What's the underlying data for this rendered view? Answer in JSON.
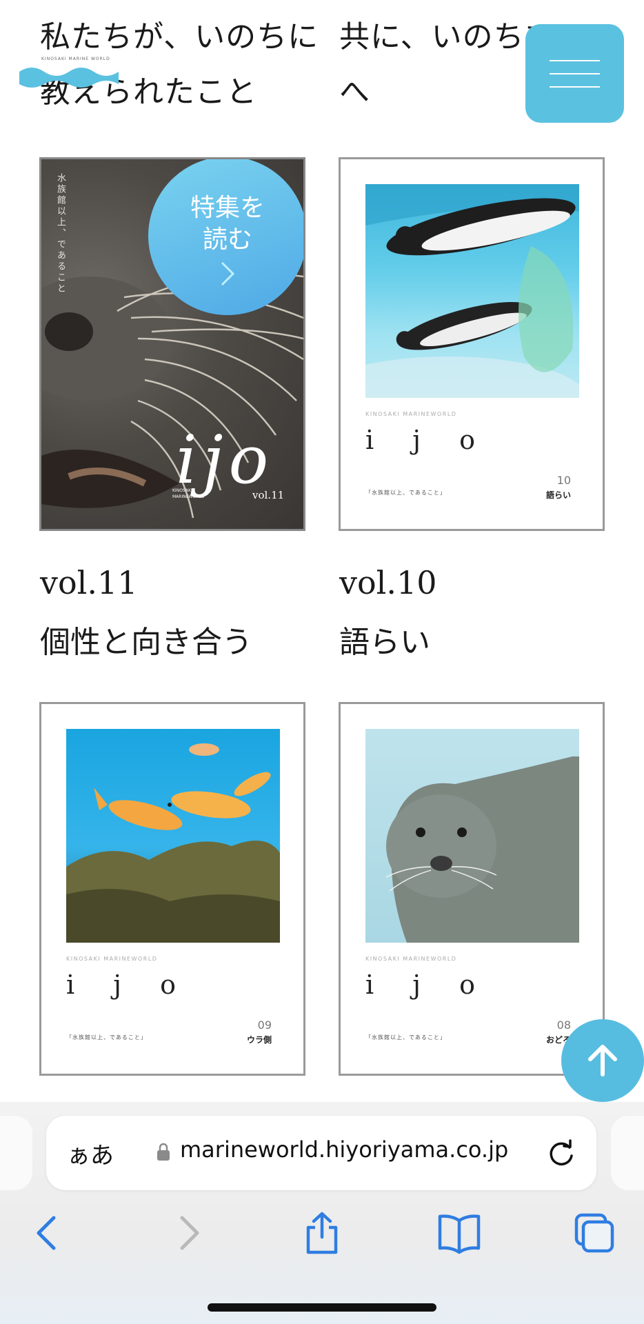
{
  "header": {
    "logo_text": "KINOSAKI MARINE WORLD",
    "col1_title_line1": "私たちが、いのちに",
    "col1_title_line2": "教えられたこと",
    "col2_title_line1": "共に、いのちを",
    "col2_title_line2": "へ"
  },
  "issues": [
    {
      "cover_vertical_text": "水族館以上、であること",
      "cover_ijo": "ijo",
      "cover_brand": "KINOSAKI MARINEWORLD",
      "cover_vol": "vol.11",
      "badge_line1": "特集を",
      "badge_line2": "読む",
      "badge_arrow": "›",
      "label": "vol.11",
      "theme": "個性と向き合う"
    },
    {
      "brand": "KINOSAKI MARINEWORLD",
      "ijo": "i j o",
      "tagline": "「水族館以上、であること」",
      "number": "10",
      "theme_small": "語らい",
      "label": "vol.10",
      "theme": "語らい"
    },
    {
      "brand": "KINOSAKI MARINEWORLD",
      "ijo": "i j o",
      "tagline": "「水族館以上、であること」",
      "number": "09",
      "theme_small": "ウラ側"
    },
    {
      "brand": "KINOSAKI MARINEWORLD",
      "ijo": "i j o",
      "tagline": "「水族館以上、であること」",
      "number": "08",
      "theme_small": "おどろ"
    }
  ],
  "browser": {
    "text_size_button": "ぁあ",
    "url": "marineworld.hiyoriyama.co.jp"
  },
  "colors": {
    "accent": "#5bc1e0",
    "badge_gradient_top": "#7ad3ef",
    "badge_gradient_bottom": "#4fa9e6",
    "safari_blue": "#2f7de1"
  }
}
